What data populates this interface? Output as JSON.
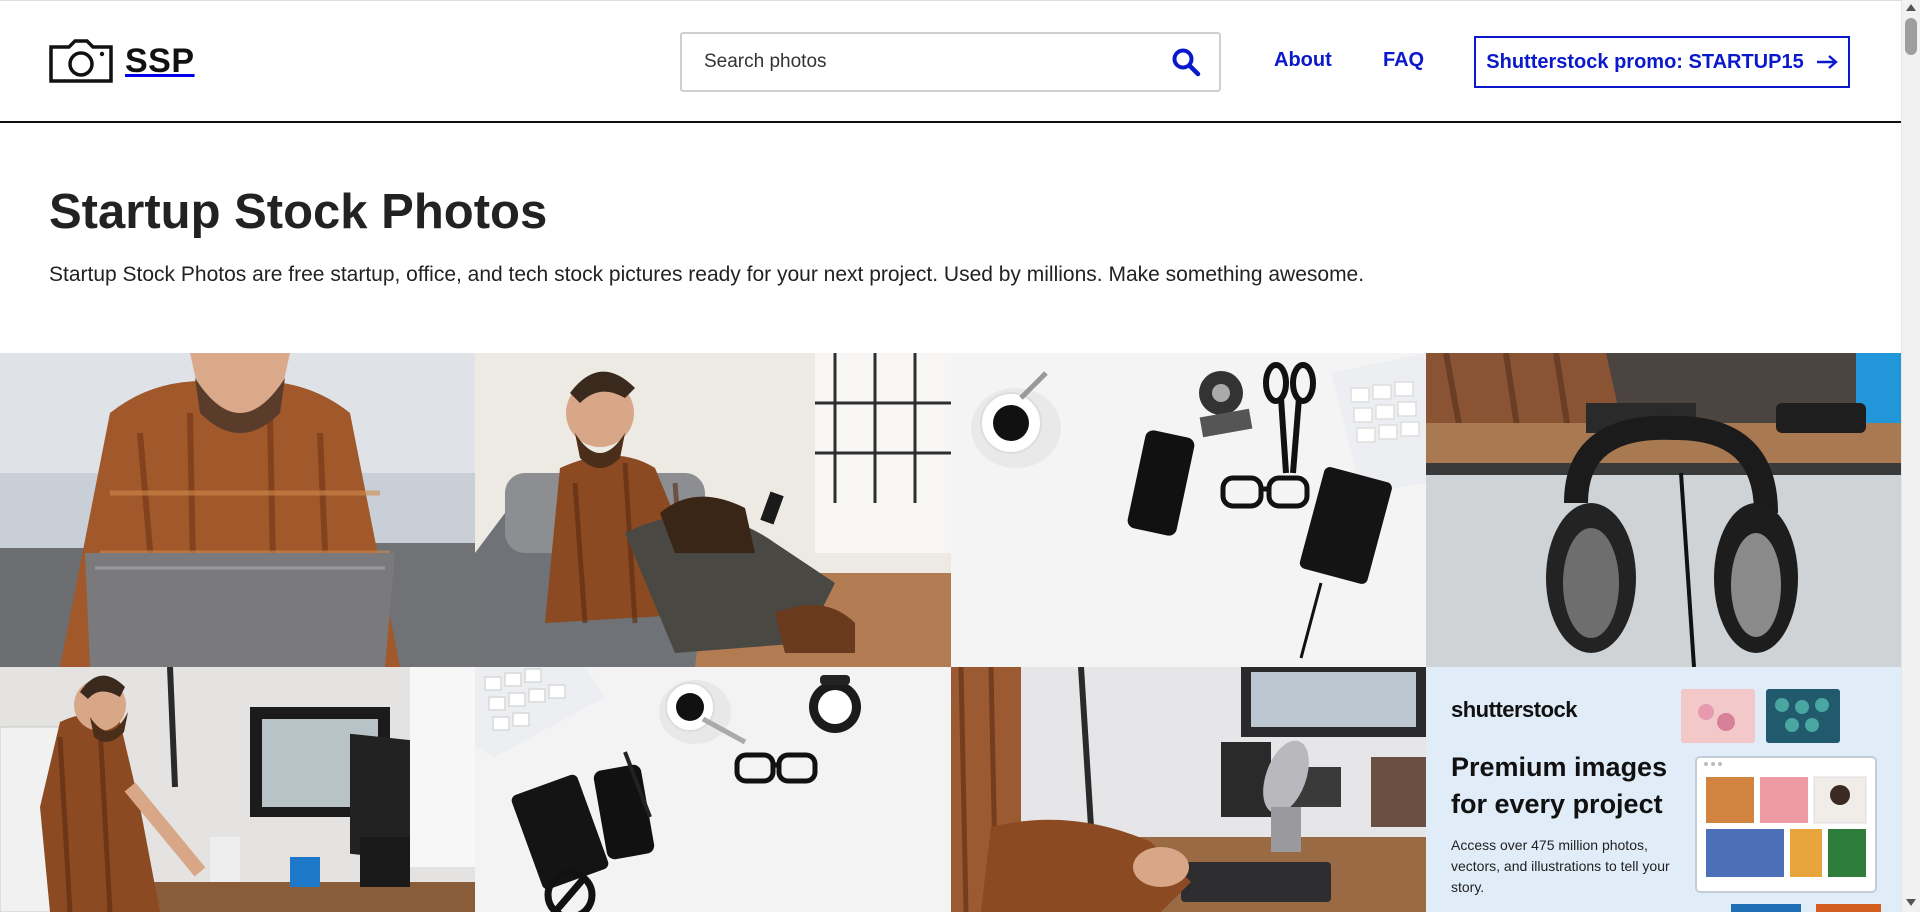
{
  "header": {
    "logo_text": "SSP",
    "search_placeholder": "Search photos",
    "nav": {
      "about": "About",
      "faq": "FAQ"
    },
    "promo_label": "Shutterstock promo: STARTUP15"
  },
  "hero": {
    "title": "Startup Stock Photos",
    "subtitle": "Startup Stock Photos are free startup, office, and tech stock pictures ready for your next project. Used by millions. Make something awesome."
  },
  "ad": {
    "brand": "shutterstock",
    "headline": "Premium images for every project",
    "body": "Access over 475 million photos, vectors, and illustrations to tell your story."
  },
  "photos": [
    {
      "name": "man-laptop-sofa"
    },
    {
      "name": "man-dog-phone"
    },
    {
      "name": "desk-flatlay-phone-glasses"
    },
    {
      "name": "headphones-desk"
    },
    {
      "name": "man-standing-desk-monitor"
    },
    {
      "name": "desk-flatlay-keyboard-clock"
    },
    {
      "name": "desk-microphone-keyboard"
    }
  ],
  "colors": {
    "accent": "#0a1acb",
    "text": "#222222",
    "ad_background": "#e0ecf8"
  }
}
